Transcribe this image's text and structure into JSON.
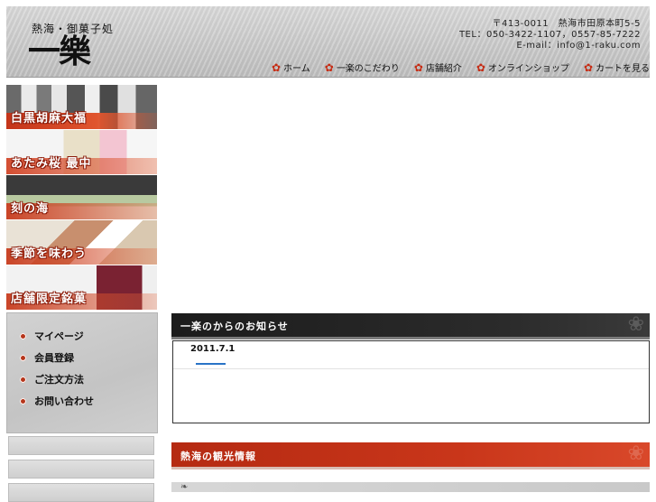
{
  "header": {
    "logo_subtitle": "熱海・御菓子処",
    "logo_name": "一樂",
    "contact": {
      "postal": "〒413-0011　熱海市田原本町5-5",
      "tel": "TEL：050-3422-1107，0557-85-7222",
      "email": "E-mail：info@1-raku.com"
    },
    "nav": [
      {
        "label": "ホーム",
        "icon": "flower-icon"
      },
      {
        "label": "一楽のこだわり",
        "icon": "flower-icon"
      },
      {
        "label": "店舗紹介",
        "icon": "flower-icon"
      },
      {
        "label": "オンラインショップ",
        "icon": "flower-icon"
      },
      {
        "label": "カートを見る",
        "icon": "flower-icon"
      }
    ]
  },
  "products": [
    {
      "label": "白黒胡麻大福"
    },
    {
      "label": "あたみ桜 最中"
    },
    {
      "label": "刻の海"
    },
    {
      "label": "季節を味わう"
    },
    {
      "label": "店舗限定銘菓"
    }
  ],
  "member_menu": [
    {
      "label": "マイページ"
    },
    {
      "label": "会員登録"
    },
    {
      "label": "ご注文方法"
    },
    {
      "label": "お問い合わせ"
    }
  ],
  "news": {
    "heading": "一楽のからのお知らせ",
    "items": [
      {
        "date": "2011.7.1"
      }
    ]
  },
  "tourism": {
    "heading": "熱海の観光情報"
  },
  "colors": {
    "accent_red": "#c52a12",
    "dark_header": "#1c1c1c",
    "link_blue": "#2a74c7"
  }
}
